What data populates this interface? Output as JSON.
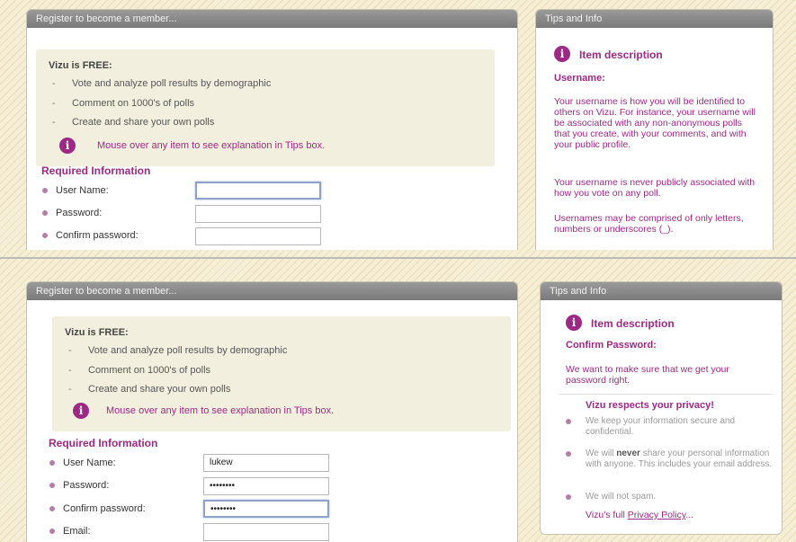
{
  "register": {
    "header": "Register to become a member...",
    "free_title": "Vizu is FREE:",
    "free_items": [
      "Vote and analyze poll results by demographic",
      "Comment on 1000's of polls",
      "Create and share your own polls"
    ],
    "mouse_over": "Mouse over any item to see explanation in Tips box.",
    "required_title": "Required Information",
    "labels": {
      "username": "User Name:",
      "password": "Password:",
      "confirm": "Confirm password:",
      "email": "Email:"
    },
    "info_glyph": "i",
    "dash": "-"
  },
  "top": {
    "values": {
      "username": "",
      "password": "",
      "confirm": ""
    },
    "tips": {
      "header": "Tips and Info",
      "title": "Item description",
      "heading": "Username:",
      "para1": "Your username is how you will be identified to others on Vizu. For instance, your username will be associated with any non-anonymous polls that you create, with your comments, and with your public profile.",
      "para2": "Your username is never publicly associated with how you vote on any poll.",
      "para3": "Usernames may be comprised of only letters, numbers or underscores (_)."
    }
  },
  "bottom": {
    "values": {
      "username": "lukew",
      "password": "••••••••",
      "confirm": "••••••••",
      "email": ""
    },
    "tips": {
      "header": "Tips and Info",
      "title": "Item description",
      "heading": "Confirm Password:",
      "para1": "We want to make sure that we get your password right.",
      "privacy_head": "Vizu respects your privacy!",
      "privacy_item1": "We keep your information secure and confidential.",
      "privacy_item2_pre": "We will ",
      "privacy_item2_bold": "never",
      "privacy_item2_post": " share your personal information with anyone. This includes your email address.",
      "privacy_item3": "We will not spam.",
      "policy_pre": "Vizu's full ",
      "policy_link": "Privacy Policy",
      "policy_post": "..."
    }
  },
  "colors": {
    "accent": "#9c2a84",
    "header_bg": "#8a8a8a",
    "background": "#f6efd5"
  },
  "icons": {
    "info": "info-circle-icon",
    "bullet": "bullet-dot-icon"
  }
}
